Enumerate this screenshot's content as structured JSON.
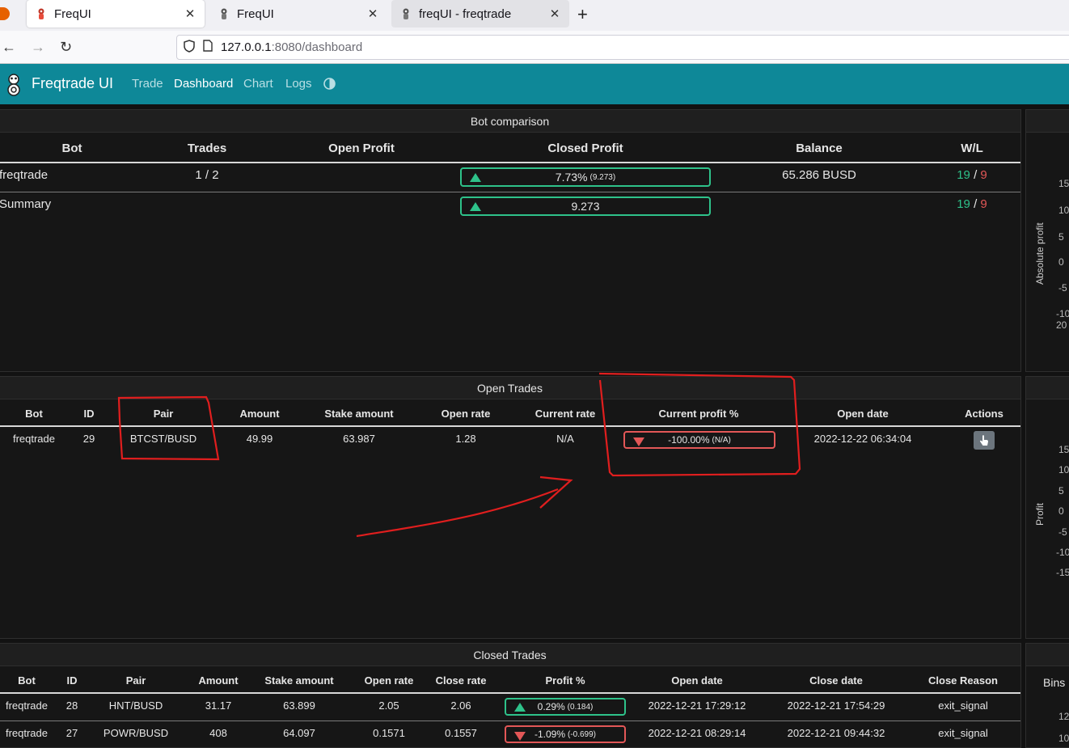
{
  "browser": {
    "tabs": [
      {
        "title": "FreqUI",
        "close": "✕"
      },
      {
        "title": "FreqUI",
        "close": "✕"
      },
      {
        "title": "freqUI - freqtrade",
        "close": "✕"
      }
    ],
    "new_tab": "+",
    "url_host": "127.0.0.1",
    "url_rest": ":8080/dashboard"
  },
  "app": {
    "brand": "Freqtrade UI",
    "nav": [
      "Trade",
      "Dashboard",
      "Chart",
      "Logs"
    ],
    "accent": "#0e8898"
  },
  "bot_comparison": {
    "title": "Bot comparison",
    "headers": [
      "Bot",
      "Trades",
      "Open Profit",
      "Closed Profit",
      "Balance",
      "W/L"
    ],
    "rows": [
      {
        "bot": "freqtrade",
        "trades": "1 / 2",
        "open_profit": "",
        "closed_profit": "7.73%",
        "closed_abs": "(9.273)",
        "balance": "65.286 BUSD",
        "wins": "19",
        "sep": "/",
        "losses": "9"
      },
      {
        "bot": "Summary",
        "trades": "",
        "open_profit": "",
        "closed_profit": "9.273",
        "closed_abs": "",
        "balance": "",
        "wins": "19",
        "sep": "/",
        "losses": "9"
      }
    ]
  },
  "open_trades": {
    "title": "Open Trades",
    "headers": [
      "Bot",
      "ID",
      "Pair",
      "Amount",
      "Stake amount",
      "Open rate",
      "Current rate",
      "Current profit %",
      "Open date",
      "Actions"
    ],
    "rows": [
      {
        "bot": "freqtrade",
        "id": "29",
        "pair": "BTCST/BUSD",
        "amount": "49.99",
        "stake": "63.987",
        "open_rate": "1.28",
        "current_rate": "N/A",
        "profit": "-100.00%",
        "profit_abs": "(N/A)",
        "open_date": "2022-12-22 06:34:04"
      }
    ]
  },
  "closed_trades": {
    "title": "Closed Trades",
    "headers": [
      "Bot",
      "ID",
      "Pair",
      "Amount",
      "Stake amount",
      "Open rate",
      "Close rate",
      "Profit %",
      "Open date",
      "Close date",
      "Close Reason"
    ],
    "rows": [
      {
        "bot": "freqtrade",
        "id": "28",
        "pair": "HNT/BUSD",
        "amount": "31.17",
        "stake": "63.899",
        "open_rate": "2.05",
        "close_rate": "2.06",
        "profit": "0.29%",
        "profit_abs": "(0.184)",
        "dir": "up",
        "open_date": "2022-12-21 17:29:12",
        "close_date": "2022-12-21 17:54:29",
        "reason": "exit_signal"
      },
      {
        "bot": "freqtrade",
        "id": "27",
        "pair": "POWR/BUSD",
        "amount": "408",
        "stake": "64.097",
        "open_rate": "0.1571",
        "close_rate": "0.1557",
        "profit": "-1.09%",
        "profit_abs": "(-0.699)",
        "dir": "down",
        "open_date": "2022-12-21 08:29:14",
        "close_date": "2022-12-21 09:44:32",
        "reason": "exit_signal"
      }
    ]
  },
  "side_charts": {
    "top_ylabel": "Absolute profit",
    "top_ticks": [
      "15",
      "10",
      "5",
      "0",
      "-5",
      "-10"
    ],
    "top_xtick": "20",
    "mid_ylabel": "Profit",
    "mid_ticks": [
      "15",
      "10",
      "5",
      "0",
      "-5",
      "-10",
      "-15"
    ],
    "bottom_label": "Bins",
    "bottom_ticks": [
      "12",
      "10"
    ]
  },
  "colors": {
    "win": "#2ec28a",
    "loss": "#e35757"
  }
}
